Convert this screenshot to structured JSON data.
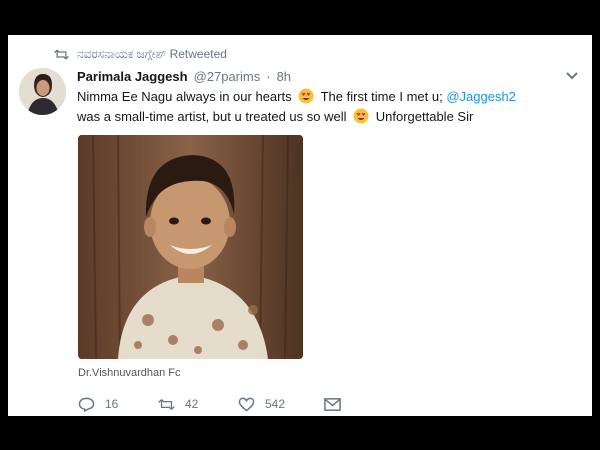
{
  "retweet": {
    "label": "ನವರಸನಾಯಕ ಜಗ್ಗೇಶ್ Retweeted"
  },
  "tweet": {
    "display_name": "Parimala Jaggesh",
    "handle": "@27parims",
    "dot": "·",
    "timestamp": "8h",
    "text_part1": "Nimma Ee Nagu always in our hearts",
    "text_part2": "The first time I met u;",
    "mention": "@Jaggesh2",
    "text_part3": "was a small-time artist, but u treated us so well",
    "text_part4": "Unforgettable Sir",
    "emoji_name": "heart-eyes-emoji",
    "image_caption": "Dr.Vishnuvardhan Fc"
  },
  "actions": {
    "reply_count": "16",
    "retweet_count": "42",
    "like_count": "542"
  },
  "colors": {
    "link": "#1b95e0",
    "secondary_text": "#657786",
    "primary_text": "#14171a",
    "frame": "#000000"
  }
}
